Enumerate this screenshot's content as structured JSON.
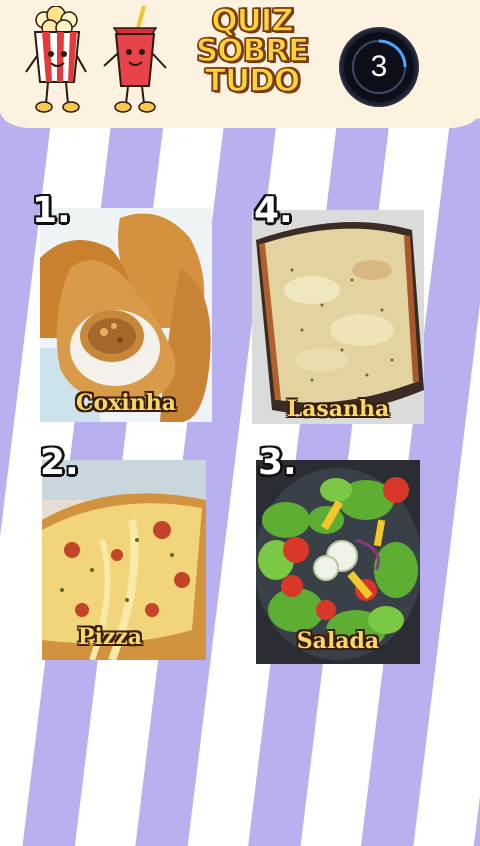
{
  "header": {
    "title_lines": [
      "QUIZ",
      "SOBRE",
      "TUDO"
    ],
    "timer": "3"
  },
  "options": [
    {
      "number": "1.",
      "label": "Coxinha",
      "image": "coxinha-photo"
    },
    {
      "number": "4.",
      "label": "Lasanha",
      "image": "lasagna-photo"
    },
    {
      "number": "2.",
      "label": "Pizza",
      "image": "pizza-photo"
    },
    {
      "number": "3.",
      "label": "Salada",
      "image": "salad-photo"
    }
  ],
  "colors": {
    "stripe": "#b9b0f0",
    "header_bg": "#fdf1e0",
    "title_fill": "#fcd437",
    "label_fill": "#f6d86a"
  }
}
